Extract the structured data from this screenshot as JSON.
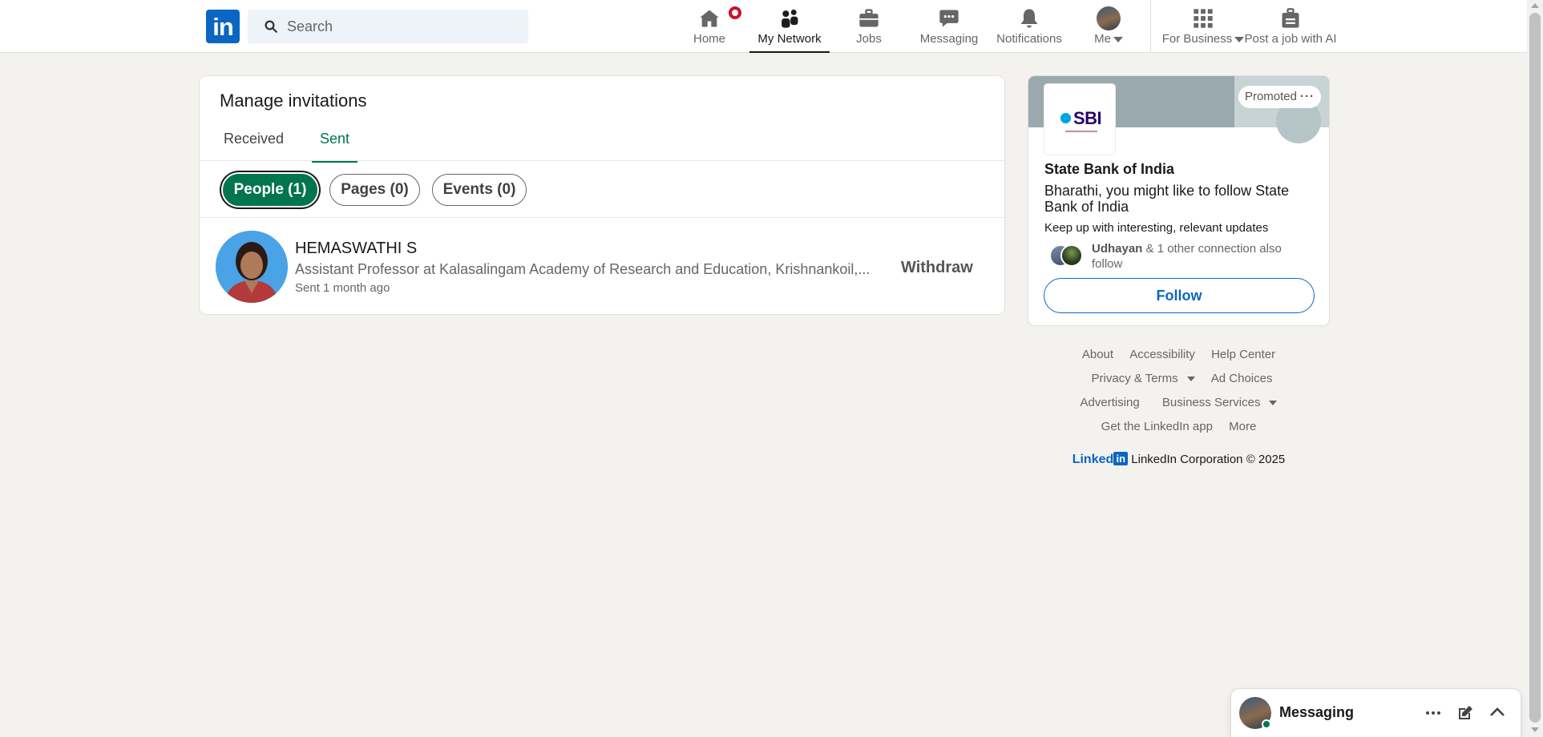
{
  "nav": {
    "logo": "in",
    "search_placeholder": "Search",
    "items": [
      {
        "label": "Home"
      },
      {
        "label": "My Network"
      },
      {
        "label": "Jobs"
      },
      {
        "label": "Messaging"
      },
      {
        "label": "Notifications"
      },
      {
        "label": "Me"
      },
      {
        "label": "For Business"
      },
      {
        "label": "Post a job with AI"
      }
    ],
    "active": "My Network"
  },
  "invitations": {
    "title": "Manage invitations",
    "tabs": [
      {
        "label": "Received"
      },
      {
        "label": "Sent"
      }
    ],
    "active_tab": "Sent",
    "filters": [
      {
        "label": "People (1)"
      },
      {
        "label": "Pages (0)"
      },
      {
        "label": "Events (0)"
      }
    ],
    "active_filter": "People (1)",
    "items": [
      {
        "name": "HEMASWATHI S",
        "headline": "Assistant Professor at Kalasalingam Academy of Research and Education, Krishnankoil,...",
        "time": "Sent 1 month ago",
        "action": "Withdraw"
      }
    ]
  },
  "ad": {
    "promoted": "Promoted",
    "more": "···",
    "logo_text": "SBI",
    "company": "State Bank of India",
    "pitch": "Bharathi, you might like to follow State Bank of India",
    "sub": "Keep up with interesting, relevant updates",
    "connection_name": "Udhayan",
    "connection_rest": " & 1 other connection also follow",
    "button": "Follow"
  },
  "footer": {
    "row1": [
      "About",
      "Accessibility",
      "Help Center"
    ],
    "row2": [
      "Privacy & Terms",
      "Ad Choices"
    ],
    "row3": [
      "Advertising",
      "Business Services"
    ],
    "row4": [
      "Get the LinkedIn app",
      "More"
    ],
    "brand_word": "Linked",
    "brand_box": "in",
    "copyright": "LinkedIn Corporation © 2025"
  },
  "messaging": {
    "title": "Messaging"
  },
  "colors": {
    "linkedin_blue": "#0a66c2",
    "green_accent": "#01754f",
    "notification_red": "#cb112d",
    "page_bg": "#f4f2ee"
  }
}
